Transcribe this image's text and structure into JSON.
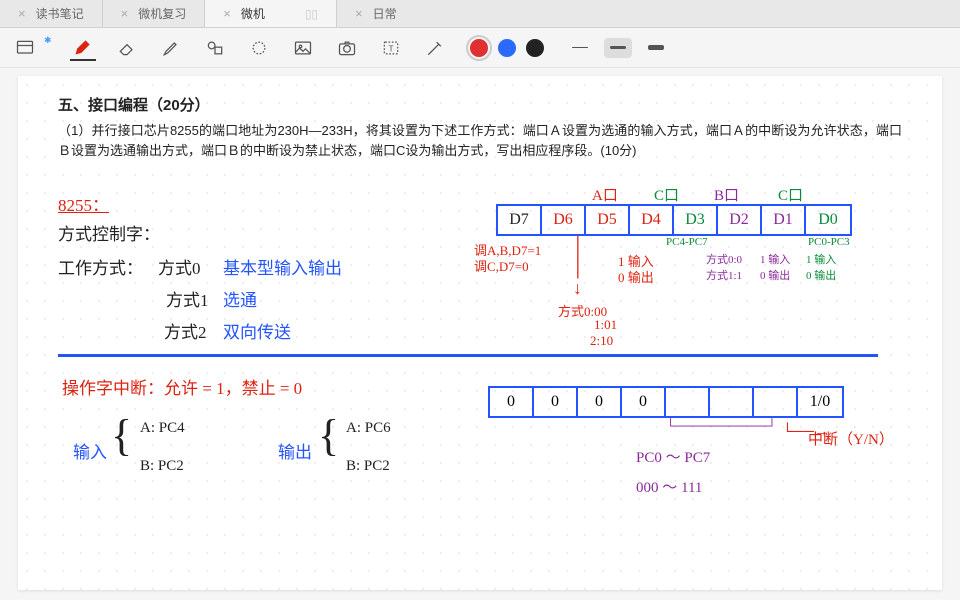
{
  "tabs": [
    {
      "label": "读书笔记"
    },
    {
      "label": "微机复习"
    },
    {
      "label": "微机",
      "active": true
    },
    {
      "label": "日常"
    }
  ],
  "title": "五、接口编程（20分）",
  "problem": "（1）并行接口芯片8255的端口地址为230H—233H，将其设置为下述工作方式：端口Ａ设置为选通的输入方式，端口Ａ的中断设为允许状态，端口Ｂ设置为选通输出方式，端口Ｂ的中断设为禁止状态，端口C设为输出方式，写出相应程序段。(10分)",
  "notes": {
    "chip": "8255：",
    "control_word": "方式控制字：",
    "mode_label": "工作方式：",
    "mode0": "方式0",
    "mode0_desc": "基本型输入输出",
    "mode1": "方式1",
    "mode1_desc": "选通",
    "mode2": "方式2",
    "mode2_desc": "双向传送",
    "headers": {
      "a": "A口",
      "c1": "C口",
      "b": "B口",
      "c2": "C口"
    },
    "bits1": [
      "D7",
      "D6",
      "D5",
      "D4",
      "D3",
      "D2",
      "D1",
      "D0"
    ],
    "d7_note1": "调A,B,D7=1",
    "d7_note2": "调C,D7=0",
    "d4_note1": "1 输入",
    "d4_note2": "0 输出",
    "pc4_7": "PC4-PC7",
    "pc0_3": "PC0-PC3",
    "d2_note1": "方式0:0",
    "d2_note2": "方式1:1",
    "d1_note1": "1 输入",
    "d1_note2": "0 输出",
    "d0_note1": "1 输入",
    "d0_note2": "0 输出",
    "mode_codes": "方式0:00",
    "mode_codes2": "1:01",
    "mode_codes3": "2:10",
    "interrupt_title": "操作字中断：允许 = 1，禁止 = 0",
    "in_label": "输入",
    "out_label": "输出",
    "in_a": "A: PC4",
    "in_b": "B: PC2",
    "out_a": "A: PC6",
    "out_b": "B: PC2",
    "bits2": [
      "0",
      "0",
      "0",
      "0",
      "",
      "",
      "",
      "1/0"
    ],
    "pc_range": "PC0 ～ PC7",
    "bin_range": "000 ～ 111",
    "int_yn": "中断（Y/N）"
  }
}
